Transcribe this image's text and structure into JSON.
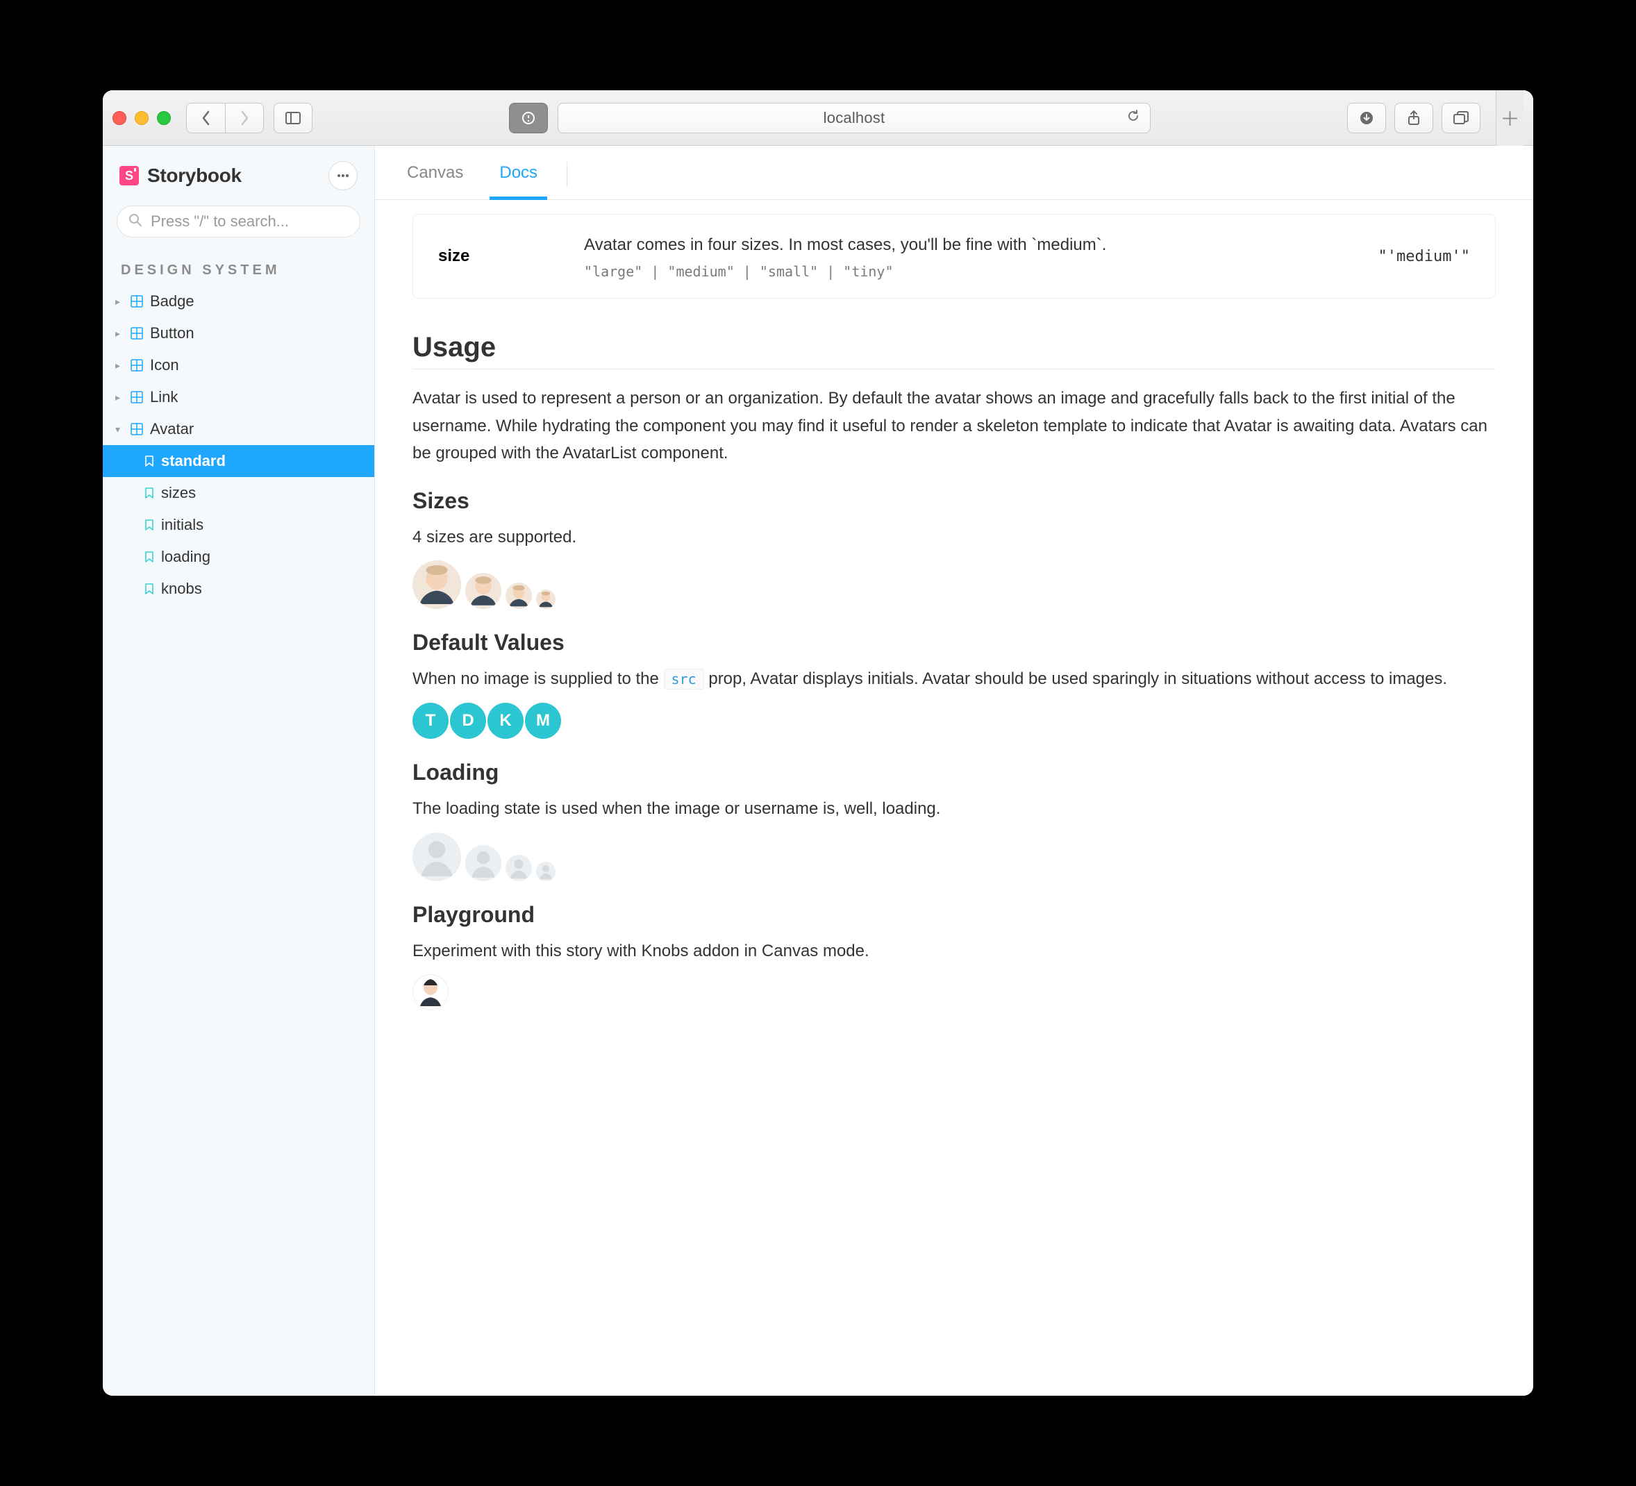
{
  "browser": {
    "url": "localhost"
  },
  "app": {
    "logo_text": "Storybook",
    "search_placeholder": "Press \"/\" to search...",
    "section_label": "DESIGN SYSTEM",
    "sidebar": {
      "components": [
        {
          "label": "Badge",
          "expanded": false
        },
        {
          "label": "Button",
          "expanded": false
        },
        {
          "label": "Icon",
          "expanded": false
        },
        {
          "label": "Link",
          "expanded": false
        },
        {
          "label": "Avatar",
          "expanded": true
        }
      ],
      "avatar_children": [
        {
          "label": "standard",
          "active": true
        },
        {
          "label": "sizes",
          "active": false
        },
        {
          "label": "initials",
          "active": false
        },
        {
          "label": "loading",
          "active": false
        },
        {
          "label": "knobs",
          "active": false
        }
      ]
    },
    "tabs": {
      "canvas": "Canvas",
      "docs": "Docs",
      "active": "Docs"
    }
  },
  "doc": {
    "prop": {
      "name": "size",
      "desc": "Avatar comes in four sizes. In most cases, you'll be fine with `medium`.",
      "type": "\"large\" | \"medium\" | \"small\" | \"tiny\"",
      "default": "\"'medium'\""
    },
    "usage": {
      "heading": "Usage",
      "body": "Avatar is used to represent a person or an organization. By default the avatar shows an image and gracefully falls back to the first initial of the username. While hydrating the component you may find it useful to render a skeleton template to indicate that Avatar is awaiting data. Avatars can be grouped with the AvatarList component."
    },
    "sizes": {
      "heading": "Sizes",
      "body": "4 sizes are supported."
    },
    "defaults": {
      "heading": "Default Values",
      "body_pre": "When no image is supplied to the ",
      "code": "src",
      "body_post": " prop, Avatar displays initials. Avatar should be used sparingly in situations without access to images.",
      "initials": [
        "T",
        "D",
        "K",
        "M"
      ]
    },
    "loading": {
      "heading": "Loading",
      "body": "The loading state is used when the image or username is, well, loading."
    },
    "playground": {
      "heading": "Playground",
      "body": "Experiment with this story with Knobs addon in Canvas mode."
    }
  }
}
